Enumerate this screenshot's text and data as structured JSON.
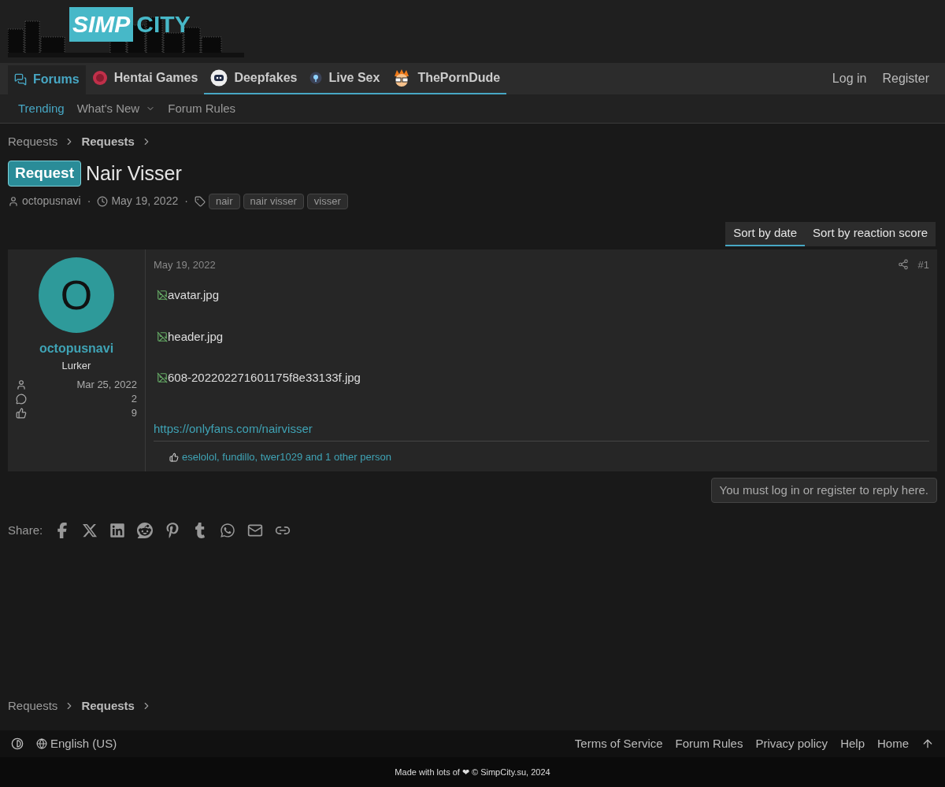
{
  "logo": {
    "word_1": "SIMP",
    "word_2": "CITY"
  },
  "nav": {
    "tabs": [
      {
        "label": "Forums",
        "kind": "forums",
        "selected": true,
        "underlined": false
      },
      {
        "label": "Hentai Games",
        "kind": "badge",
        "selected": false,
        "underlined": false
      },
      {
        "label": "Deepfakes",
        "kind": "robot",
        "selected": false,
        "underlined": true
      },
      {
        "label": "Live Sex",
        "kind": "pin",
        "selected": false,
        "underlined": true
      },
      {
        "label": "ThePornDude",
        "kind": "dude",
        "selected": false,
        "underlined": true
      }
    ],
    "account": [
      "Log in",
      "Register"
    ]
  },
  "subnav": [
    {
      "label": "Trending",
      "selected": true,
      "has_menu": false
    },
    {
      "label": "What's New",
      "selected": false,
      "has_menu": true
    },
    {
      "label": "Forum Rules",
      "selected": false,
      "has_menu": false
    }
  ],
  "breadcrumb_top": [
    {
      "label": "Requests",
      "bold": false
    },
    {
      "label": "Requests",
      "bold": true
    }
  ],
  "thread": {
    "prefix": "Request",
    "title": "Nair Visser",
    "author": "octopusnavi",
    "separator_1": "·",
    "date": "May 19, 2022",
    "separator_2": "·",
    "tags": [
      "nair",
      "nair visser",
      "visser"
    ]
  },
  "sort": [
    {
      "label": "Sort by date",
      "selected": true
    },
    {
      "label": "Sort by reaction score",
      "selected": false
    }
  ],
  "post": {
    "user": {
      "initial": "O",
      "name": "octopusnavi",
      "role": "Lurker",
      "stats": [
        {
          "kind": "joined",
          "value": "Mar 25, 2022"
        },
        {
          "kind": "messages",
          "value": "2"
        },
        {
          "kind": "reactions",
          "value": "9"
        }
      ]
    },
    "date": "May 19, 2022",
    "number": "#1",
    "images": [
      "avatar.jpg",
      "header.jpg",
      "608-202202271601175f8e33133f.jpg"
    ],
    "link": "https://onlyfans.com/nairvisser",
    "reactions": "eselolol, fundillo, twer1029 and 1 other person"
  },
  "reply_notice": "You must log in or register to reply here.",
  "share": {
    "label": "Share:",
    "services": [
      {
        "kind": "facebook"
      },
      {
        "kind": "x"
      },
      {
        "kind": "linkedin"
      },
      {
        "kind": "reddit"
      },
      {
        "kind": "pinterest"
      },
      {
        "kind": "tumblr"
      },
      {
        "kind": "whatsapp"
      },
      {
        "kind": "email"
      },
      {
        "kind": "link"
      }
    ]
  },
  "breadcrumb_bottom": [
    {
      "label": "Requests",
      "bold": false
    },
    {
      "label": "Requests",
      "bold": true
    }
  ],
  "footer": {
    "language": "English (US)",
    "links": [
      "Terms of Service",
      "Forum Rules",
      "Privacy policy",
      "Help",
      "Home"
    ],
    "copyright": "Made with lots of ❤ © SimpCity.su, 2024"
  }
}
